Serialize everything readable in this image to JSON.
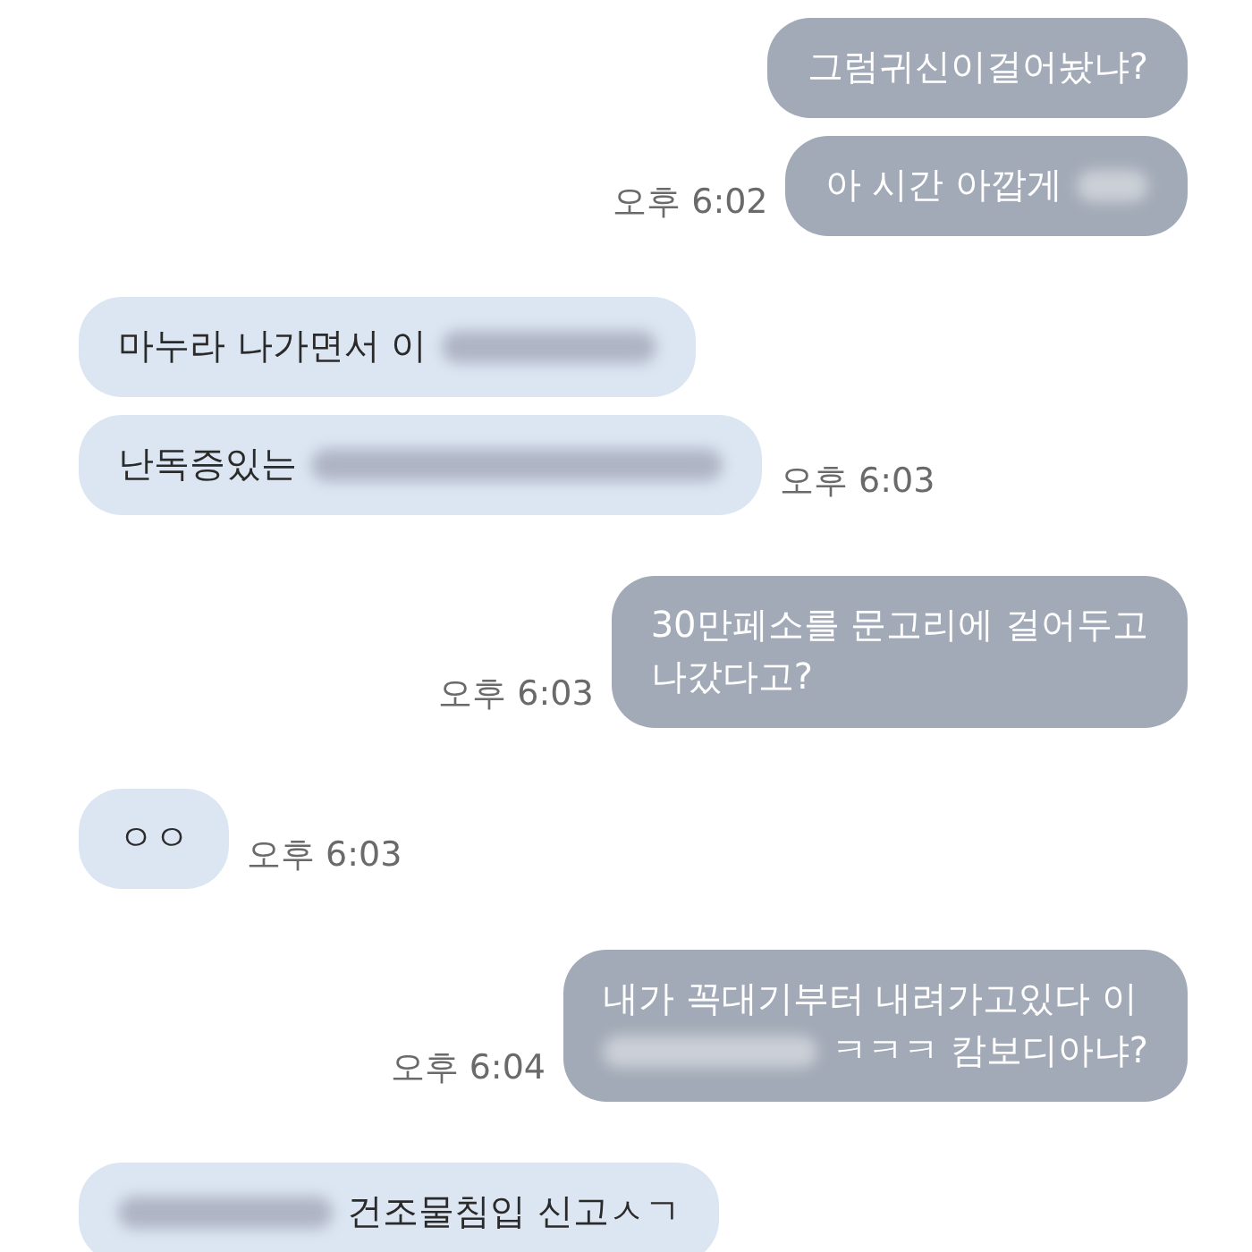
{
  "messages": [
    {
      "kind": "outgoing",
      "lines": [
        [
          {
            "kind": "text",
            "text": "그럼귀신이걸어놨냐?"
          }
        ]
      ]
    },
    {
      "kind": "outgoing",
      "time": "오후 6:02",
      "lines": [
        [
          {
            "kind": "text",
            "text": "아 시간 아깝게"
          },
          {
            "kind": "blur_tiny"
          }
        ]
      ]
    },
    {
      "kind": "incoming",
      "lines": [
        [
          {
            "kind": "text",
            "text": "마누라 나가면서 이"
          },
          {
            "kind": "blur_short"
          }
        ]
      ]
    },
    {
      "kind": "incoming",
      "time": "오후 6:03",
      "lines": [
        [
          {
            "kind": "text",
            "text": "난독증있는"
          },
          {
            "kind": "blur_long"
          }
        ]
      ]
    },
    {
      "kind": "outgoing",
      "time": "오후 6:03",
      "lines": [
        [
          {
            "kind": "text",
            "text": "30만페소를 문고리에 걸어두고"
          }
        ],
        [
          {
            "kind": "text",
            "text": "나갔다고?"
          }
        ]
      ]
    },
    {
      "kind": "incoming",
      "time": "오후 6:03",
      "lines": [
        [
          {
            "kind": "text",
            "text": "ㅇㅇ"
          }
        ]
      ]
    },
    {
      "kind": "outgoing",
      "time": "오후 6:04",
      "lines": [
        [
          {
            "kind": "text",
            "text": "내가 꼭대기부터 내려가고있다 이"
          }
        ],
        [
          {
            "kind": "blur_short"
          },
          {
            "kind": "text",
            "text": "ㅋㅋㅋ 캄보디아냐?"
          }
        ]
      ]
    },
    {
      "kind": "incoming",
      "lines": [
        [
          {
            "kind": "blur_short"
          },
          {
            "kind": "text",
            "text": "건조물침입 신고ㅅㄱ"
          }
        ]
      ]
    }
  ]
}
